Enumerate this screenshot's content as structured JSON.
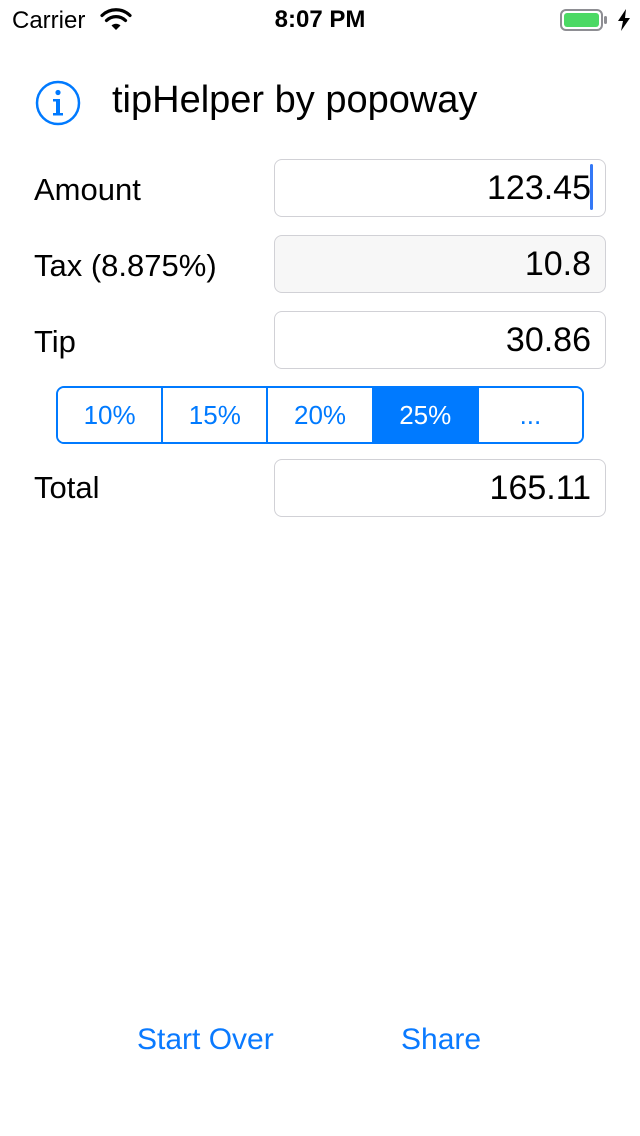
{
  "status_bar": {
    "carrier": "Carrier",
    "time": "8:07 PM",
    "battery_color": "#4cd964"
  },
  "header": {
    "info_icon": "info-icon",
    "title": "tipHelper by popoway"
  },
  "form": {
    "amount": {
      "label": "Amount",
      "value": "123.45"
    },
    "tax": {
      "label": "Tax (8.875%)",
      "value": "10.8"
    },
    "tip": {
      "label": "Tip",
      "value": "30.86"
    },
    "tip_options": [
      {
        "label": "10%",
        "selected": false
      },
      {
        "label": "15%",
        "selected": false
      },
      {
        "label": "20%",
        "selected": false
      },
      {
        "label": "25%",
        "selected": true
      },
      {
        "label": "...",
        "selected": false
      }
    ],
    "total": {
      "label": "Total",
      "value": "165.11"
    }
  },
  "footer": {
    "start_over_label": "Start Over",
    "share_label": "Share"
  },
  "colors": {
    "accent": "#007aff",
    "field_border": "#d1d1d6",
    "readonly_field_bg": "#f7f7f7"
  }
}
